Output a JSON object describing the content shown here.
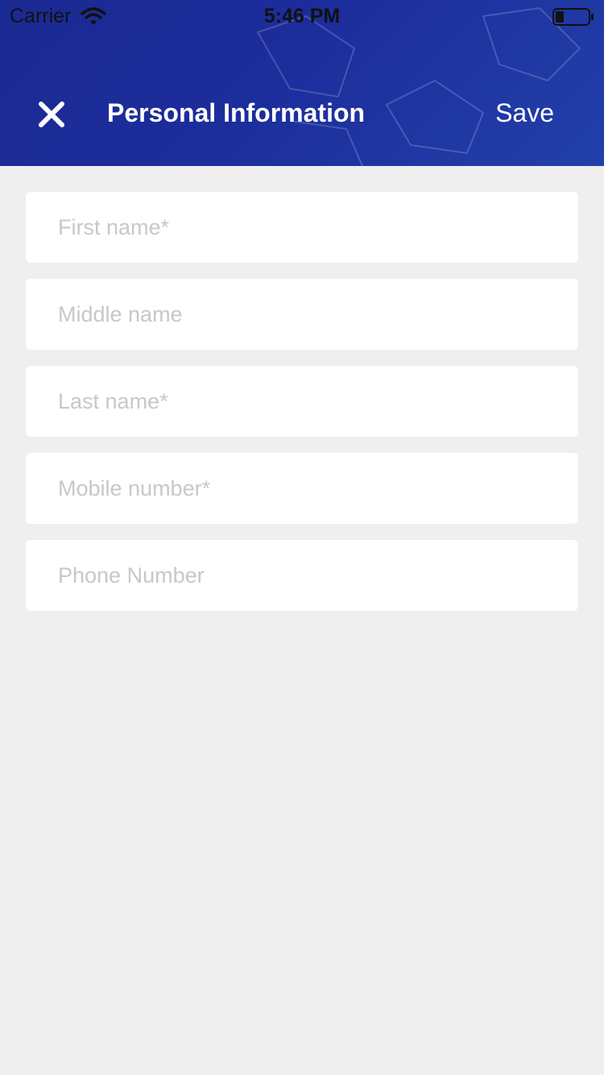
{
  "status_bar": {
    "carrier": "Carrier",
    "time": "5:46 PM",
    "wifi_icon": "wifi-icon",
    "battery_icon": "battery-icon"
  },
  "header": {
    "title": "Personal Information",
    "save_label": "Save",
    "close_icon": "close-icon",
    "background_color": "#1c2d9c",
    "text_color": "#ffffff"
  },
  "form": {
    "fields": [
      {
        "placeholder": "First name*",
        "value": ""
      },
      {
        "placeholder": "Middle name",
        "value": ""
      },
      {
        "placeholder": "Last name*",
        "value": ""
      },
      {
        "placeholder": "Mobile number*",
        "value": ""
      },
      {
        "placeholder": "Phone Number",
        "value": ""
      }
    ]
  },
  "colors": {
    "page_background": "#efefef",
    "field_background": "#ffffff",
    "placeholder": "#c7c7cc"
  }
}
